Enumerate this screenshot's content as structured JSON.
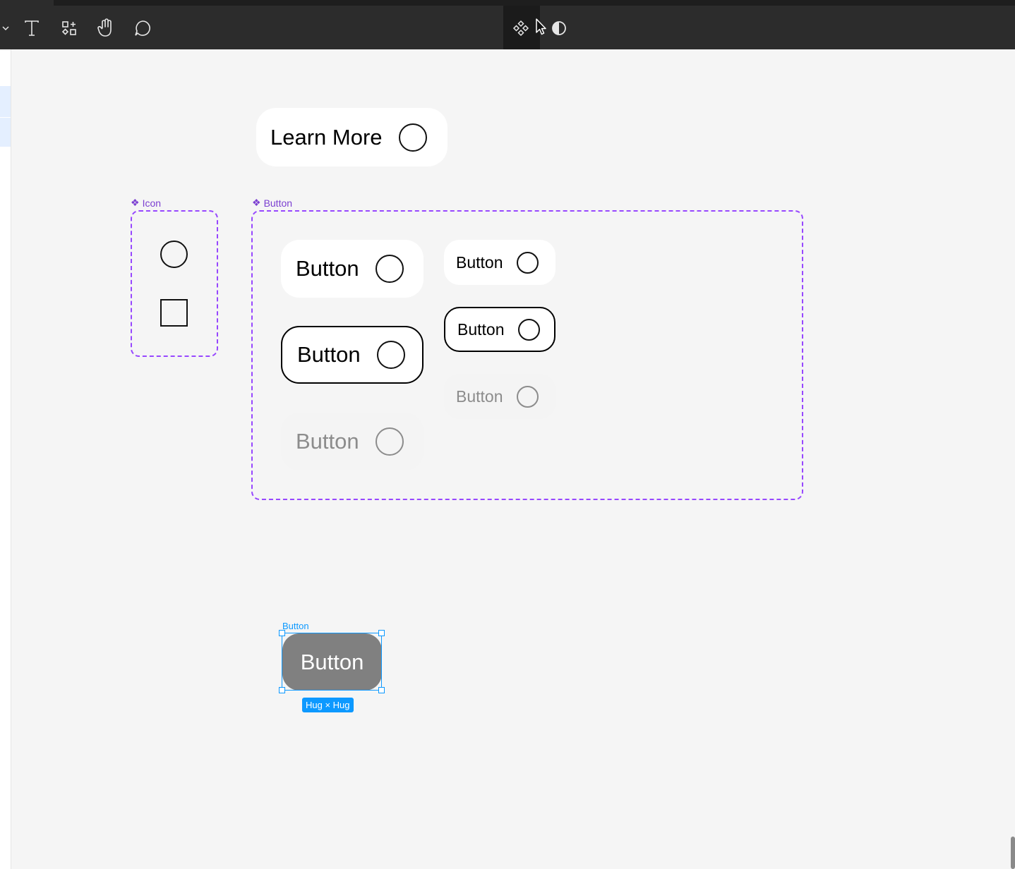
{
  "toolbar": {
    "tools": [
      {
        "name": "chevron-down-icon"
      },
      {
        "name": "text-tool-icon"
      },
      {
        "name": "resources-icon"
      },
      {
        "name": "hand-tool-icon"
      },
      {
        "name": "comment-icon"
      }
    ],
    "center": [
      {
        "name": "component-icon"
      },
      {
        "name": "cursor-icon"
      },
      {
        "name": "contrast-icon"
      }
    ]
  },
  "canvas": {
    "learn_more": {
      "label": "Learn More"
    },
    "icon_frame": {
      "label": "Icon"
    },
    "button_frame": {
      "label": "Button"
    },
    "variants": {
      "large_default": "Button",
      "large_outline": "Button",
      "large_disabled": "Button",
      "small_default": "Button",
      "small_outline": "Button",
      "small_disabled": "Button"
    },
    "selected": {
      "layer_label": "Button",
      "text": "Button",
      "size_badge": "Hug × Hug"
    }
  },
  "colors": {
    "component_purple": "#9747ff",
    "selection_blue": "#0d99ff",
    "toolbar_bg": "#2c2c2c",
    "canvas_bg": "#f5f5f5"
  }
}
